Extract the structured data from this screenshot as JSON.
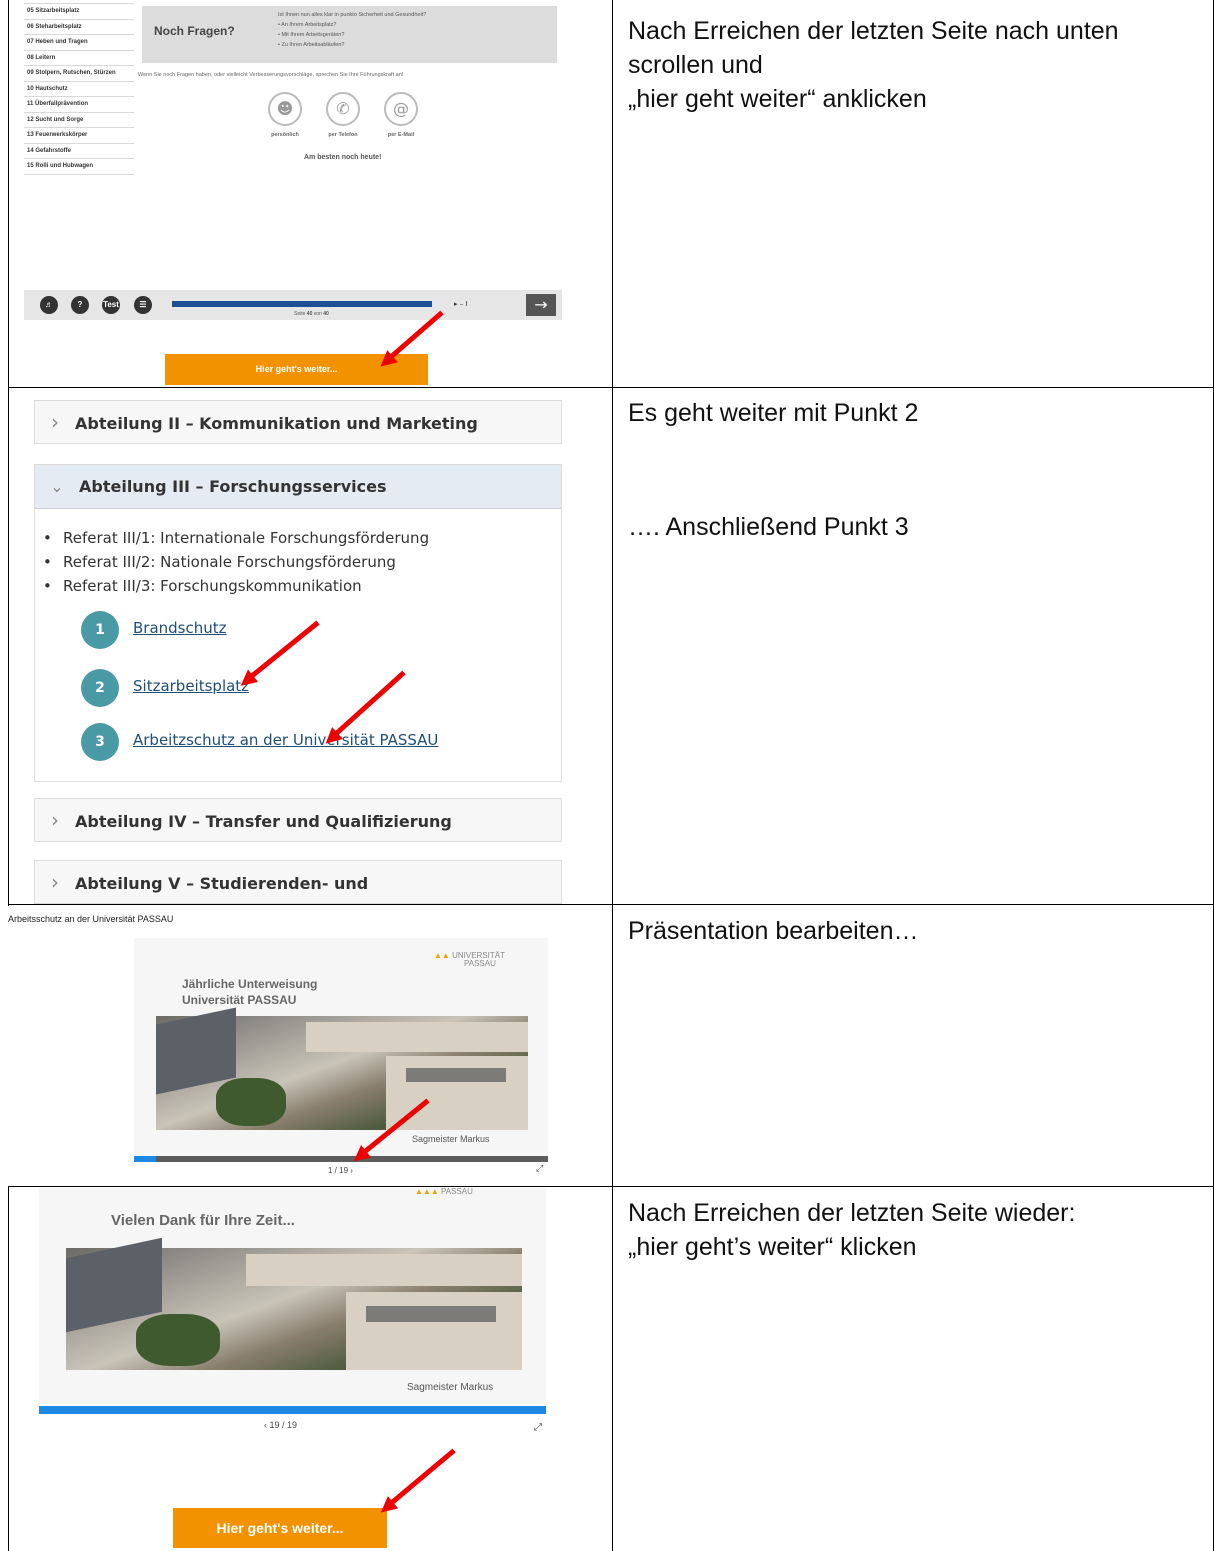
{
  "row1": {
    "note_lines": [
      "Nach Erreichen der letzten Seite nach unten",
      "scrollen und",
      "„hier geht weiter“ anklicken"
    ],
    "shot": {
      "nav_items": [
        "05 Sitzarbeitsplatz",
        "06 Steharbeitsplatz",
        "07 Heben und Tragen",
        "08 Leitern",
        "09 Stolpern, Rutschen, Stürzen",
        "10 Hautschutz",
        "11 Überfallprävention",
        "12 Sucht und Sorge",
        "13 Feuerwerkskörper",
        "14 Gefahrstoffe",
        "15 Rolli und Hubwagen"
      ],
      "heading": "Noch Fragen?",
      "question_lines": [
        "Ist Ihnen nun alles klar in punkto Sicherheit und Gesundheit?",
        "• An Ihrem Arbeitsplatz?",
        "• Mit Ihrem Arbeitsgeräten?",
        "• Zu Ihren Arbeitsabläufen?"
      ],
      "paragraph": "Wenn Sie noch Fragen haben, oder vielleicht Verbesserungsvorschläge, sprechen Sie Ihre Führungskraft an!",
      "contact_labels": [
        "persönlich",
        "per Telefon",
        "per E-Mail"
      ],
      "closing": "Am besten noch heute!",
      "toolbar_test": "Test",
      "page_text_prefix": "Seite ",
      "page_current": "40",
      "page_sep": " von ",
      "page_total": "40",
      "progress_fraction": 1.0,
      "continue_button": "Hier geht's weiter..."
    }
  },
  "row2": {
    "note_line1": "Es geht weiter mit Punkt 2",
    "note_line2": "…. Anschließend Punkt 3",
    "shot": {
      "accordion_closed_1": "Abteilung II – Kommunikation und Marketing",
      "accordion_open": "Abteilung III – Forschungsservices",
      "referate": [
        "Referat III/1: Internationale Forschungsförderung",
        "Referat III/2: Nationale Forschungsförderung",
        "Referat III/3: Forschungskommunikation"
      ],
      "steps": [
        {
          "num": "1",
          "label": "Brandschutz"
        },
        {
          "num": "2",
          "label": "Sitzarbeitsplatz"
        },
        {
          "num": "3",
          "label": "Arbeitzschutz an der Universität PASSAU"
        }
      ],
      "accordion_closed_2": "Abteilung IV – Transfer und Qualifizierung",
      "accordion_closed_3": "Abteilung V – Studierenden- und Rechtsangelegenheiten"
    }
  },
  "row3": {
    "note": "Präsentation bearbeiten…",
    "shot": {
      "title": "Arbeitsschutz an der Universität PASSAU",
      "logo_line1": "UNIVERSITÄT",
      "logo_line2": "PASSAU",
      "slide_title_1": "Jährliche Unterweisung",
      "slide_title_2": "Universität PASSAU",
      "author": "Sagmeister Markus",
      "counter": "1 / 19 ›",
      "progress_fraction": 0.053
    }
  },
  "row4": {
    "note_line1": "Nach Erreichen der letzten Seite wieder:",
    "note_line2": "„hier geht’s weiter“ klicken",
    "shot": {
      "logo_line2": "PASSAU",
      "slide_title": "Vielen Dank für Ihre Zeit...",
      "author": "Sagmeister Markus",
      "counter": "‹ 19 / 19",
      "progress_fraction": 1.0,
      "continue_button": "Hier geht's weiter..."
    }
  }
}
